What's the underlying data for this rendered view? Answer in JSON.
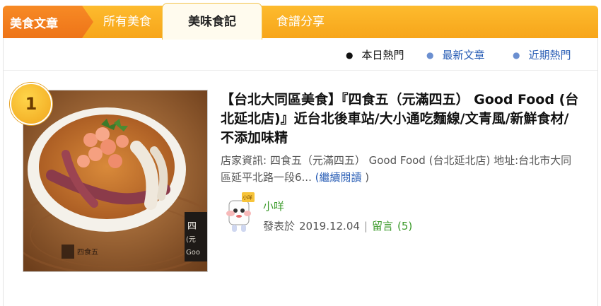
{
  "tabs": {
    "main": "美食文章",
    "all": "所有美食",
    "active": "美味食記",
    "recipe": "食譜分享"
  },
  "subnav": [
    {
      "label": "本日熱門"
    },
    {
      "label": "最新文章"
    },
    {
      "label": "近期熱門"
    }
  ],
  "article": {
    "rank": "1",
    "title": "【台北大同區美食】『四食五（元滿四五） Good Food (台北延北店)』近台北後車站/大小通吃麵線/文青風/新鮮食材/不添加味精",
    "summary": "店家資訊: 四食五（元滿四五） Good Food (台北延北店) 地址:台北市大同區延平北路一段6...",
    "more_open": "(",
    "more_label": "繼續閱讀",
    "more_close": " )",
    "image_overlay_text": [
      "四",
      "(元",
      "Goo"
    ],
    "brand_mark": "四食五",
    "author": "小咩",
    "avatar_tag": "小咩",
    "published_label": "發表於",
    "published_date": "2019.12.04",
    "separator": "|",
    "comments_label": "留言",
    "comments_count": "(5)"
  },
  "colors": {
    "tab_bar": "#f7a51a",
    "tab_main": "#ee7418",
    "link_blue": "#2b5fb6",
    "author_green": "#3b9a2a"
  }
}
